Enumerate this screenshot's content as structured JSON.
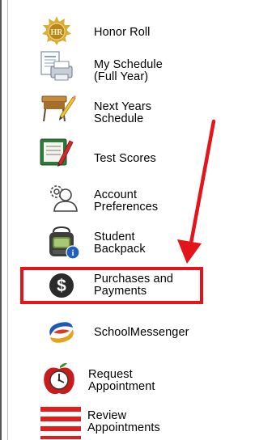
{
  "sidebar": {
    "items": [
      {
        "label": "Honor Roll",
        "icon": "honor-roll-medal-icon"
      },
      {
        "label": "My Schedule\n(Full Year)",
        "icon": "schedule-printer-icon"
      },
      {
        "label": "Next Years\nSchedule",
        "icon": "school-desk-icon"
      },
      {
        "label": "Test Scores",
        "icon": "test-scores-icon"
      },
      {
        "label": "Account\nPreferences",
        "icon": "account-person-gear-icon"
      },
      {
        "label": "Student\nBackpack",
        "icon": "backpack-info-icon"
      },
      {
        "label": "Purchases and\nPayments",
        "icon": "dollar-circle-icon"
      },
      {
        "label": "SchoolMessenger",
        "icon": "schoolmessenger-logo-icon"
      },
      {
        "label": "Request\nAppointment",
        "icon": "apple-clock-icon"
      },
      {
        "label": "Review\nAppointments",
        "icon": "red-lines-icon"
      }
    ]
  },
  "annotation": {
    "highlighted_item": "Purchases and Payments",
    "color": "#e3141b"
  }
}
